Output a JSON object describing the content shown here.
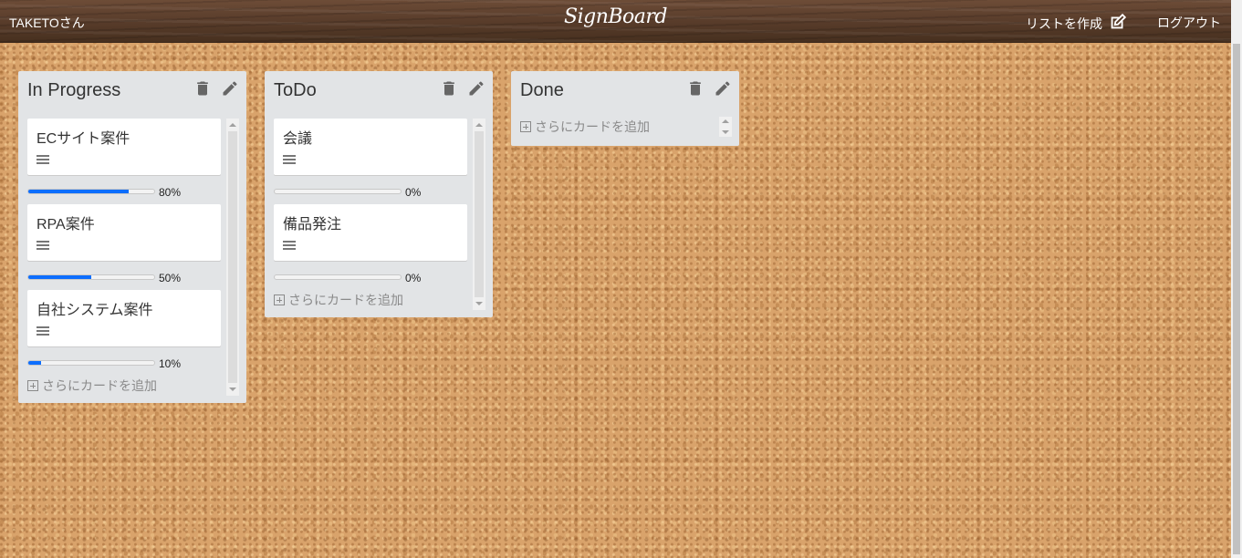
{
  "header": {
    "user": "TAKETOさん",
    "logo": "SignBoard",
    "create_list": "リストを作成",
    "logout": "ログアウト"
  },
  "icons": {
    "delete": "trash-icon",
    "edit": "pencil-icon",
    "create": "edit-square-icon",
    "menu": "hamburger-icon",
    "add": "plus-square-icon"
  },
  "colors": {
    "progress": "#0d6efd",
    "list_bg": "#e2e4e6",
    "header": "#5a3d2b"
  },
  "add_card_label": "さらにカードを追加",
  "lists": [
    {
      "title": "In Progress",
      "cards": [
        {
          "title": "ECサイト案件",
          "progress": 80,
          "progress_label": "80%"
        },
        {
          "title": "RPA案件",
          "progress": 50,
          "progress_label": "50%"
        },
        {
          "title": "自社システム案件",
          "progress": 10,
          "progress_label": "10%"
        }
      ]
    },
    {
      "title": "ToDo",
      "cards": [
        {
          "title": "会議",
          "progress": 0,
          "progress_label": "0%"
        },
        {
          "title": "備品発注",
          "progress": 0,
          "progress_label": "0%"
        }
      ]
    },
    {
      "title": "Done",
      "cards": []
    }
  ]
}
